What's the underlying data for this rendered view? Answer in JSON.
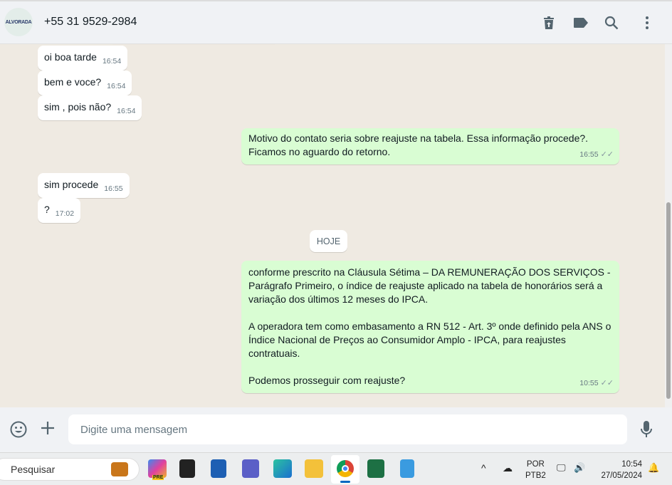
{
  "header": {
    "avatar_text": "ALVORADA",
    "contact": "+55 31 9529-2984"
  },
  "messages": [
    {
      "dir": "in",
      "text": "oi boa tarde",
      "time": "16:54"
    },
    {
      "dir": "in",
      "text": "bem e voce?",
      "time": "16:54"
    },
    {
      "dir": "in",
      "text": "sim , pois não?",
      "time": "16:54"
    },
    {
      "dir": "out",
      "lines": [
        "Motivo do contato seria sobre reajuste na tabela. Essa informação procede?.",
        "Ficamos no aguardo do retorno."
      ],
      "time": "16:55"
    },
    {
      "dir": "in",
      "text": "sim procede",
      "time": "16:55"
    },
    {
      "dir": "in",
      "text": "?",
      "time": "17:02"
    },
    {
      "dir": "out",
      "paragraphs": [
        "conforme prescrito na Cláusula Sétima – DA REMUNERAÇÃO DOS SERVIÇOS - Parágrafo Primeiro, o índice de reajuste aplicado na tabela de honorários será a variação dos últimos 12 meses do IPCA.",
        "A operadora tem como embasamento a RN 512 - Art. 3º onde definido pela ANS o Índice Nacional de Preços ao Consumidor Amplo - IPCA, para reajustes contratuais.",
        "Podemos prosseguir com reajuste?"
      ],
      "time": "10:55"
    }
  ],
  "date_divider": "HOJE",
  "composer": {
    "placeholder": "Digite uma mensagem"
  },
  "taskbar": {
    "search": "Pesquisar",
    "lang1": "POR",
    "lang2": "PTB2",
    "time": "10:54",
    "date": "27/05/2024",
    "copilot_badge": "PRE"
  }
}
